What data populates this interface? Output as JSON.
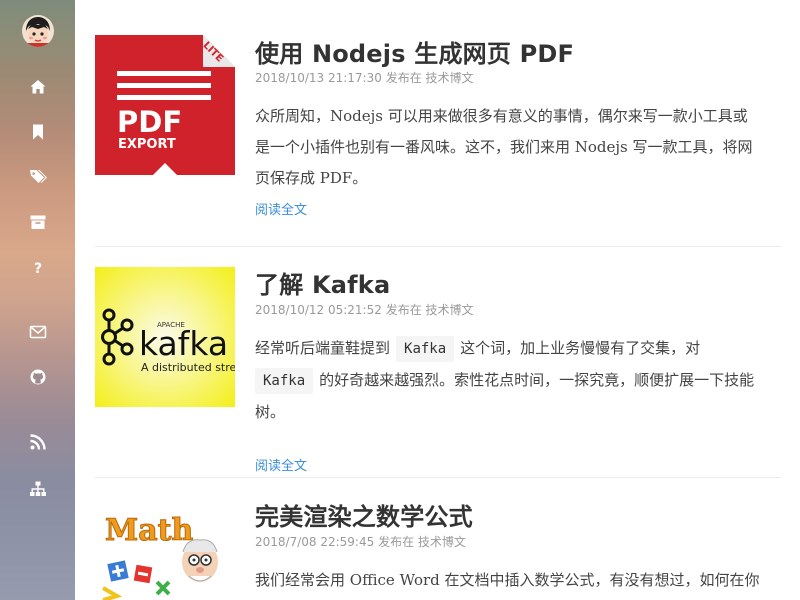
{
  "sidebar": {
    "nav": [
      {
        "name": "home-icon",
        "label": "home"
      },
      {
        "name": "bookmark-icon",
        "label": "bookmark"
      },
      {
        "name": "tags-icon",
        "label": "tags"
      },
      {
        "name": "archive-icon",
        "label": "archive"
      },
      {
        "name": "question-icon",
        "label": "about"
      },
      {
        "name": "mail-icon",
        "label": "mail"
      },
      {
        "name": "github-icon",
        "label": "github"
      },
      {
        "name": "rss-icon",
        "label": "rss"
      },
      {
        "name": "sitemap-icon",
        "label": "sitemap"
      }
    ]
  },
  "thumbs": {
    "pdf": {
      "main": "PDF",
      "sub": "EXPORT",
      "ribbon": "LITE"
    },
    "kafka": {
      "apache": "APACHE",
      "brand": "kafka",
      "tagline": "A distributed stre"
    },
    "math": {
      "word": "Math"
    }
  },
  "posts": [
    {
      "title": "使用 Nodejs 生成网页 PDF",
      "date": "2018/10/13 21:17:30",
      "posted_in": "发布在",
      "category": "技术博文",
      "excerpt_lines": [
        "众所周知，Nodejs 可以用来做很多有意义的事情，偶尔来写一款小工具或",
        "是一个小插件也别有一番风味。这不，我们来用 Nodejs 写一款工具，将网",
        "页保存成 PDF。"
      ],
      "read_more": "阅读全文"
    },
    {
      "title": "了解 Kafka",
      "date": "2018/10/12 05:21:52",
      "posted_in": "发布在",
      "category": "技术博文",
      "excerpt_a": "经常听后端童鞋提到",
      "code1": "Kafka",
      "excerpt_b": "这个词，加上业务慢慢有了交集，对",
      "code2": "Kafka",
      "excerpt_c": "的好奇越来越强烈。索性花点时间，一探究竟，顺便扩展一下技能",
      "excerpt_d": "树。",
      "read_more": "阅读全文"
    },
    {
      "title": "完美渲染之数学公式",
      "date": "2018/7/08 22:59:45",
      "posted_in": "发布在",
      "category": "技术博文",
      "excerpt_lines": [
        "我们经常会用 Office Word 在文档中插入数学公式，有没有想过，如何在你"
      ]
    }
  ],
  "colors": {
    "accent": "#3b8ed8",
    "pdf_red": "#d0222a",
    "kafka_yellow": "#f5f230"
  }
}
